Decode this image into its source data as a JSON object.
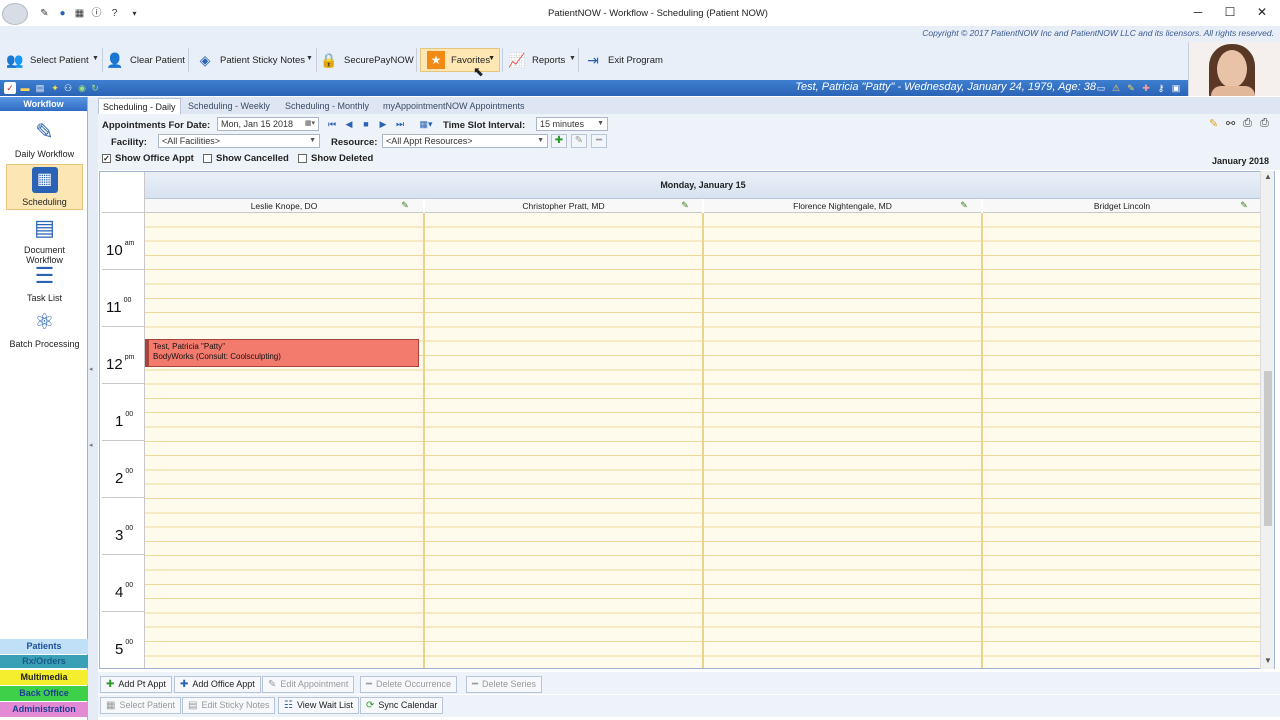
{
  "window": {
    "title": "PatientNOW - Workflow - Scheduling (Patient NOW)"
  },
  "copyright": "Copyright © 2017 PatientNOW Inc and PatientNOW LLC and its licensors. All rights reserved.",
  "toolbar": {
    "select_patient": "Select Patient",
    "clear_patient": "Clear Patient",
    "sticky_notes": "Patient Sticky Notes",
    "securepay": "SecurePayNOW",
    "favorites": "Favorites",
    "reports": "Reports",
    "exit": "Exit Program"
  },
  "patient_banner": "Test, Patricia \"Patty\" - Wednesday, January 24, 1979, Age: 38",
  "sidebar": {
    "header": "Workflow",
    "items": [
      {
        "label": "Daily Workflow",
        "icon": "clipboard-check-icon"
      },
      {
        "label": "Scheduling",
        "icon": "calendar-icon"
      },
      {
        "label": "Document Workflow",
        "icon": "document-icon"
      },
      {
        "label": "Task List",
        "icon": "task-list-icon"
      },
      {
        "label": "Batch Processing",
        "icon": "atom-icon"
      }
    ],
    "bottom": [
      "Patients",
      "Rx/Orders",
      "Multimedia",
      "Back Office",
      "Administration"
    ]
  },
  "tabs": [
    "Scheduling - Daily",
    "Scheduling - Weekly",
    "Scheduling - Monthly",
    "myAppointmentNOW Appointments"
  ],
  "controls": {
    "appt_date_label": "Appointments For Date:",
    "appt_date_value": "Mon, Jan 15 2018",
    "time_slot_label": "Time Slot Interval:",
    "time_slot_value": "15 minutes",
    "facility_label": "Facility:",
    "facility_value": "<All Facilities>",
    "resource_label": "Resource:",
    "resource_value": "<All Appt Resources>",
    "show_office_appt": "Show Office Appt",
    "show_cancelled": "Show Cancelled",
    "show_deleted": "Show Deleted",
    "month_label": "January 2018"
  },
  "calendar": {
    "day_header": "Monday, January 15",
    "providers": [
      "Leslie Knope, DO",
      "Christopher Pratt, MD",
      "Florence Nightengale, MD",
      "Bridget Lincoln"
    ],
    "hours": [
      {
        "h": "10",
        "s": "am"
      },
      {
        "h": "11",
        "s": "00"
      },
      {
        "h": "12",
        "s": "pm"
      },
      {
        "h": "1",
        "s": "00"
      },
      {
        "h": "2",
        "s": "00"
      },
      {
        "h": "3",
        "s": "00"
      },
      {
        "h": "4",
        "s": "00"
      },
      {
        "h": "5",
        "s": "00"
      }
    ],
    "appointment": {
      "patient": "Test, Patricia \"Patty\"",
      "detail": "BodyWorks (Consult: Coolsculpting)"
    }
  },
  "actions": {
    "add_pt_appt": "Add Pt Appt",
    "add_office_appt": "Add Office Appt",
    "edit_appointment": "Edit Appointment",
    "delete_occurrence": "Delete Occurrence",
    "delete_series": "Delete Series",
    "select_patient": "Select Patient",
    "edit_sticky_notes": "Edit Sticky Notes",
    "view_wait_list": "View Wait List",
    "sync_calendar": "Sync Calendar"
  },
  "colors": {
    "accent_blue": "#2a63b6",
    "appointment": "#f37b6e",
    "slot_bg": "#fffbec",
    "favorites_bg": "#ffe7b3"
  }
}
